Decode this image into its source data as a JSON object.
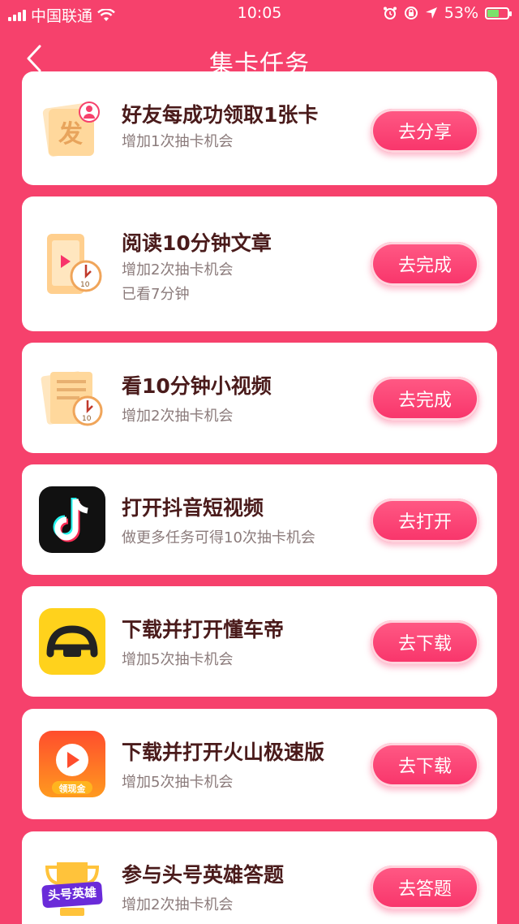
{
  "status_bar": {
    "carrier": "中国联通",
    "time": "10:05",
    "battery": "53%"
  },
  "nav": {
    "title": "集卡任务"
  },
  "tasks": [
    {
      "title": "好友每成功领取1张卡",
      "sub": "增加1次抽卡机会",
      "sub2": "",
      "button": "去分享",
      "icon": "gift-card-share-icon"
    },
    {
      "title": "阅读10分钟文章",
      "sub": "增加2次抽卡机会",
      "sub2": "已看7分钟",
      "button": "去完成",
      "icon": "read-article-timer-icon"
    },
    {
      "title": "看10分钟小视频",
      "sub": "增加2次抽卡机会",
      "sub2": "",
      "button": "去完成",
      "icon": "watch-video-timer-icon"
    },
    {
      "title": "打开抖音短视频",
      "sub": "做更多任务可得10次抽卡机会",
      "sub2": "",
      "button": "去打开",
      "icon": "douyin-app-icon"
    },
    {
      "title": "下载并打开懂车帝",
      "sub": "增加5次抽卡机会",
      "sub2": "",
      "button": "去下载",
      "icon": "dongchedi-app-icon"
    },
    {
      "title": "下载并打开火山极速版",
      "sub": "增加5次抽卡机会",
      "sub2": "",
      "button": "去下载",
      "icon": "huoshan-app-icon",
      "icon_label": "领现金"
    },
    {
      "title": "参与头号英雄答题",
      "sub": "增加2次抽卡机会",
      "sub2": "",
      "button": "去答题",
      "icon": "toutiao-hero-quiz-icon",
      "icon_label": "头号英雄"
    }
  ],
  "colors": {
    "background": "#f6416c",
    "button": "#f8346a",
    "title_text": "#4a1b1b",
    "sub_text": "#8b7b7b"
  }
}
